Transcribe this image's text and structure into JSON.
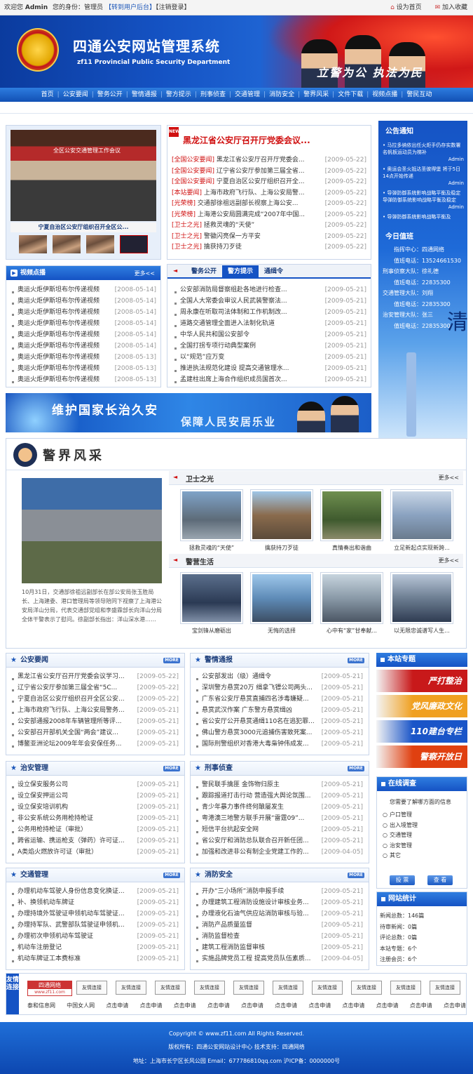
{
  "topbar": {
    "welcome": "欢迎您",
    "user": "Admin",
    "role_label": "您的身份：管理员",
    "admin_link": "【转到用户后台】",
    "logout": "【注销登录】",
    "homepage": "设为首页",
    "favorite": "加入收藏"
  },
  "header": {
    "title": "四通公安网站管理系统",
    "subtitle": "zf11 Provincial Public Security Department",
    "slogan": "立警为公  执法为民"
  },
  "nav": [
    "首页",
    "公安要闻",
    "警务公开",
    "警情通报",
    "警方提示",
    "刑事侦查",
    "交通管理",
    "消防安全",
    "警界风采",
    "文件下载",
    "视频点播",
    "警民互动"
  ],
  "slide": {
    "caption": "宁夏自治区公安厅组织召开全区公...",
    "banner_text": "全区公安交通管理工作会议"
  },
  "headline": {
    "title": "黑龙江省公安厅召开厅党委会议...",
    "items": [
      {
        "cat": "[全国公安要闻]",
        "title": "黑龙江省公安厅召开厅党委会...",
        "date": "[2009-05-22]"
      },
      {
        "cat": "[全国公安要闻]",
        "title": "辽宁省公安厅参加第三届全省...",
        "date": "[2009-05-22]"
      },
      {
        "cat": "[全国公安要闻]",
        "title": "宁夏自治区公安厅组织召开全...",
        "date": "[2009-05-22]"
      },
      {
        "cat": "[本站要闻]",
        "title": "上海市政府飞行队、上海公安局警...",
        "date": "[2009-05-22]"
      },
      {
        "cat": "[光荣榜]",
        "title": "交通部徐祖远副部长视察上海公安...",
        "date": "[2009-05-22]"
      },
      {
        "cat": "[光荣榜]",
        "title": "上海港公安局圆满完成“2007年中国...",
        "date": "[2009-05-22]"
      },
      {
        "cat": "[卫士之光]",
        "title": "拯救灵魂的“天使”",
        "date": "[2009-05-22]"
      },
      {
        "cat": "[卫士之光]",
        "title": "警徽闪亮保一方平安",
        "date": "[2009-05-22]"
      },
      {
        "cat": "[卫士之光]",
        "title": "擒获持刀歹徒",
        "date": "[2009-05-22]"
      }
    ]
  },
  "notice": {
    "title": "公告通知",
    "items": [
      {
        "text": "马拉多纳依出任火炬手仍存实数署名帆板运动员为梯补",
        "author": "Admin"
      },
      {
        "text": "奥运会圣火抵达圣彼得堡 将于5日14点开始传递",
        "author": "Admin"
      },
      {
        "text": "导弹防御系统影响战略平衡及稳定导弹防御系统影响战略平衡及稳定",
        "author": "Admin"
      },
      {
        "text": "导弹防御系统影响战略平衡及",
        "author": ""
      }
    ]
  },
  "duty": {
    "title": "今日值班",
    "rows": [
      {
        "label": "指挥中心：",
        "value": "四通网络"
      },
      {
        "label": "值班电话：",
        "value": "13524661530"
      },
      {
        "label": "刑事侦察大队：",
        "value": "徐礼德"
      },
      {
        "label": "值班电话：",
        "value": "22835300"
      },
      {
        "label": "交通管理大队：",
        "value": "刘翔"
      },
      {
        "label": "值班电话：",
        "value": "22835300"
      },
      {
        "label": "治安管理大队：",
        "value": "张三"
      },
      {
        "label": "值班电话：",
        "value": "22835300"
      }
    ]
  },
  "video": {
    "title": "视频点播",
    "more": "更多<<",
    "items": [
      {
        "title": "奥运火炬伊斯坦布尔传递视频",
        "date": "[2008-05-14]"
      },
      {
        "title": "奥运火炬伊斯坦布尔传递视频",
        "date": "[2008-05-14]"
      },
      {
        "title": "奥运火炬伊斯坦布尔传递视频",
        "date": "[2008-05-14]"
      },
      {
        "title": "奥运火炬伊斯坦布尔传递视频",
        "date": "[2008-05-14]"
      },
      {
        "title": "奥运火炬伊斯坦布尔传递视频",
        "date": "[2008-05-14]"
      },
      {
        "title": "奥运火炬伊斯坦布尔传递视频",
        "date": "[2008-05-14]"
      },
      {
        "title": "奥运火炬伊斯坦布尔传递视频",
        "date": "[2008-05-13]"
      },
      {
        "title": "奥运火炬伊斯坦布尔传递视频",
        "date": "[2008-05-13]"
      },
      {
        "title": "奥运火炬伊斯坦布尔传递视频",
        "date": "[2008-05-13]"
      }
    ]
  },
  "tabs": {
    "labels": [
      "警务公开",
      "警方提示",
      "通缉令"
    ],
    "items": [
      {
        "title": "公安部消防局督察组赴各地进行检查...",
        "date": "[2009-05-21]"
      },
      {
        "title": "全国人大常委会审议人民武装警察法...",
        "date": "[2009-05-21]"
      },
      {
        "title": "周永康在听取司法体制和工作机制改...",
        "date": "[2009-05-21]"
      },
      {
        "title": "道路交通管理全面进入法制化轨道",
        "date": "[2009-05-21]"
      },
      {
        "title": "中华人民共和国公安部令",
        "date": "[2009-05-21]"
      },
      {
        "title": "全国打拐专项行动典型案例",
        "date": "[2009-05-21]"
      },
      {
        "title": "以“规范”应万变",
        "date": "[2009-05-21]"
      },
      {
        "title": "推进执法规范化建设 提高交通管理水...",
        "date": "[2009-05-21]"
      },
      {
        "title": "孟建柱出席上海合作组织成员国首次...",
        "date": "[2009-05-21]"
      }
    ]
  },
  "midbanner": {
    "left": "维护国家长治久安",
    "right": "保障人民安居乐业"
  },
  "style": {
    "title": "警界风采",
    "feature_text": "10月31日，交通部徐祖远副部长在部公安局张玉胜局长、上海建委、港口管理局等领导陪同下视察了上海港公安局洋山分局，代表交通部党组和李盛霖部长向洋山分局全体干警表示了慰问。徐副部长指出：洋山深水港……",
    "guard": {
      "title": "卫士之光",
      "more": "更多<<",
      "items": [
        "拯救灵魂的“天使”",
        "擒获持刀歹徒",
        "真情奏出和谐曲",
        "立足新起点实现新跨..."
      ]
    },
    "life": {
      "title": "警营生活",
      "more": "更多<<",
      "items": [
        "宝剑锋从磨砺出",
        "无悔的选择",
        "心中有“家”甘奉献...",
        "以无限忠诚谱写人生..."
      ]
    }
  },
  "sections": [
    {
      "title": "公安要闻",
      "items": [
        {
          "t": "黑龙江省公安厅召开厅党委会议学习...",
          "d": "[2009-05-22]"
        },
        {
          "t": "辽宁省公安厅参加第三届全省“5C...",
          "d": "[2009-05-22]"
        },
        {
          "t": "宁夏自治区公安厅组织召开全区公安...",
          "d": "[2009-05-22]"
        },
        {
          "t": "上海市政府飞行队、上海公安局警务...",
          "d": "[2009-05-21]"
        },
        {
          "t": "公安部通报2008年车辆管理所等评...",
          "d": "[2009-05-21]"
        },
        {
          "t": "公安部召开部机关全国“两会”建议...",
          "d": "[2009-05-21]"
        },
        {
          "t": "博鳌亚洲论坛2009年年会安保任务...",
          "d": "[2009-05-21]"
        }
      ]
    },
    {
      "title": "警情通报",
      "items": [
        {
          "t": "公安部发出（级）通缉令",
          "d": "[2009-05-21]"
        },
        {
          "t": "深圳警方悬赏20万 缉拿飞镖公司两头...",
          "d": "[2009-05-21]"
        },
        {
          "t": "广东省公安厅悬赏直捕四名涉毒嫌疑...",
          "d": "[2009-05-21]"
        },
        {
          "t": "悬赏武汉作案 广东警方悬赏缉凶",
          "d": "[2009-05-21]"
        },
        {
          "t": "省公安厅公开悬赏通缉110名在逃犯罪...",
          "d": "[2009-05-21]"
        },
        {
          "t": "佛山警方悬赏3000元追捕伤害致死案...",
          "d": "[2009-05-21]"
        },
        {
          "t": "国际刑警组织对香港大毒枭钟伟成发...",
          "d": "[2009-05-21]"
        }
      ]
    },
    {
      "title": "治安管理",
      "items": [
        {
          "t": "设立保安服务公司",
          "d": "[2009-05-21]"
        },
        {
          "t": "设立保安押运公司",
          "d": "[2009-05-21]"
        },
        {
          "t": "设立保安培训机构",
          "d": "[2009-05-21]"
        },
        {
          "t": "非公安系统公务用枪持枪证",
          "d": "[2009-05-21]"
        },
        {
          "t": "公务用枪持枪证（审批）",
          "d": "[2009-05-21]"
        },
        {
          "t": "跨省运输、携运枪支（弹药）许可证...",
          "d": "[2009-05-21]"
        },
        {
          "t": "A类焰火燃放许可证（审批）",
          "d": "[2009-05-21]"
        }
      ]
    },
    {
      "title": "刑事侦查",
      "items": [
        {
          "t": "警民联手擒匪 金饰物归原主",
          "d": "[2009-05-21]"
        },
        {
          "t": "跟踪报道打击行动 营造强大舆论氛围...",
          "d": "[2009-05-21]"
        },
        {
          "t": "青少年暴力事件终何酿屡发生",
          "d": "[2009-05-21]"
        },
        {
          "t": "粤港澳三地警方联手开展“雷霆09”...",
          "d": "[2009-05-21]"
        },
        {
          "t": "短信平台抗起安全网",
          "d": "[2009-05-21]"
        },
        {
          "t": "省公安厅和消防总队联合召开新任团...",
          "d": "[2009-05-21]"
        },
        {
          "t": "加强和改进非公有制企业党建工作的...",
          "d": "[2009-04-05]"
        }
      ]
    },
    {
      "title": "交通管理",
      "items": [
        {
          "t": "办理机动车驾驶人身份信息变化换证...",
          "d": "[2009-05-21]"
        },
        {
          "t": "补、换领机动车牌证",
          "d": "[2009-05-21]"
        },
        {
          "t": "办理持境外驾驶证申领机动车驾驶证...",
          "d": "[2009-05-21]"
        },
        {
          "t": "办理持军队、武警部队驾驶证申领机...",
          "d": "[2009-05-21]"
        },
        {
          "t": "办理初次申领机动车驾驶证",
          "d": "[2009-05-21]"
        },
        {
          "t": "机动车注册登记",
          "d": "[2009-05-21]"
        },
        {
          "t": "机动车牌证工本费标准",
          "d": "[2009-05-21]"
        }
      ]
    },
    {
      "title": "消防安全",
      "items": [
        {
          "t": "开办“三小场所”消防申报手续",
          "d": "[2009-05-21]"
        },
        {
          "t": "办理建筑工程消防设施设计审核业务...",
          "d": "[2009-05-21]"
        },
        {
          "t": "办理液化石油气供应站消防审核与验...",
          "d": "[2009-05-21]"
        },
        {
          "t": "消防产品质量监督",
          "d": "[2009-05-21]"
        },
        {
          "t": "消防监督检查",
          "d": "[2009-05-21]"
        },
        {
          "t": "建筑工程消防监督审核",
          "d": "[2009-05-21]"
        },
        {
          "t": "实施品牌党员工程 提高党员队伍素质...",
          "d": "[2009-04-05]"
        }
      ]
    }
  ],
  "more_tag": "MORE",
  "topics": {
    "title": "本站专题",
    "items": [
      "严打整治",
      "党风廉政文化",
      "110建台专栏",
      "警察开放日"
    ],
    "colors": [
      "#c8191a",
      "#f0a020",
      "#1a55c8",
      "#e04010"
    ]
  },
  "survey": {
    "title": "在线调查",
    "question": "您需要了解哪方面的信息",
    "options": [
      "户口管理",
      "出入境管理",
      "交通管理",
      "治安管理",
      "其它"
    ],
    "vote": "投 票",
    "view": "查 看"
  },
  "stats": {
    "title": "网站统计",
    "rows": [
      {
        "label": "新闻总数：",
        "value": "146篇"
      },
      {
        "label": "待审新闻：",
        "value": "0篇"
      },
      {
        "label": "评论总数：",
        "value": "0篇"
      },
      {
        "label": "本站专题：",
        "value": "6个"
      },
      {
        "label": "注册会员：",
        "value": "6个"
      }
    ]
  },
  "links": {
    "title": "友情连接",
    "logo": "四通网络",
    "logo_sub": "www.zf11.com",
    "first_row": [
      "友情连接",
      "友情连接",
      "友情连接",
      "友情连接",
      "友情连接",
      "友情连接",
      "友情连接",
      "友情连接",
      "友情连接",
      "友情连接"
    ],
    "second_row": [
      "泰和信息网",
      "中国女人网",
      "点击申请",
      "点击申请",
      "点击申请",
      "点击申请",
      "点击申请",
      "点击申请",
      "点击申请",
      "点击申请",
      "点击申请",
      "点击申请",
      "点击申请"
    ]
  },
  "footer": {
    "line1": "Copyright © www.zf11.com All Rights Reserved.",
    "line2": "版权所有：四通公安网站设计中心 技术支持：四通网络",
    "line3": "地址：上海市长宁区长风公园 Email：677786810qq.com 沪ICP备：0000000号"
  }
}
